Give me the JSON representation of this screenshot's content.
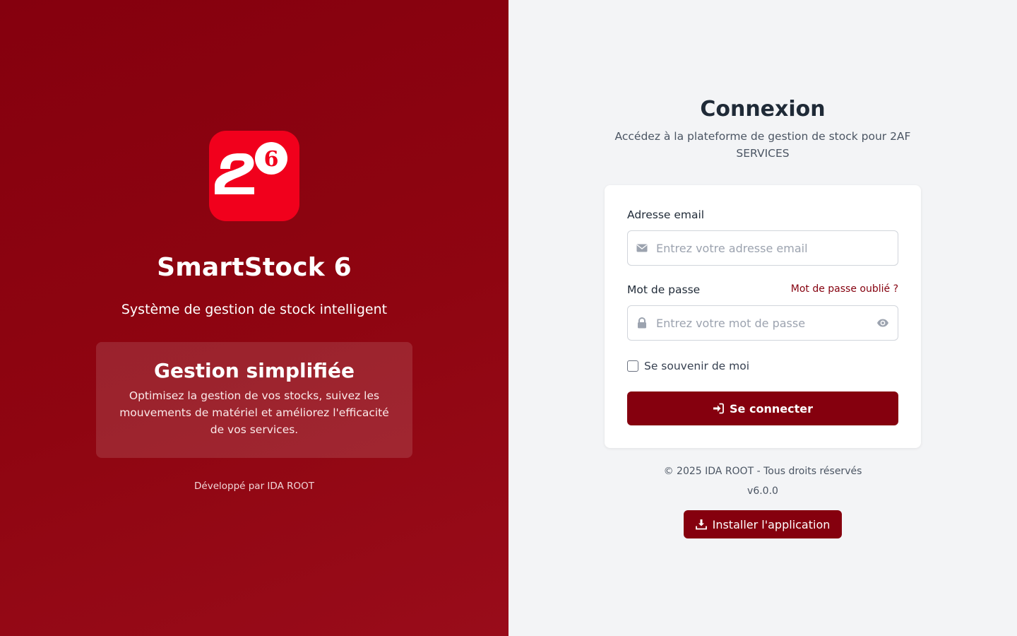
{
  "brand": {
    "app_name": "SmartStock 6",
    "tagline": "Système de gestion de stock intelligent",
    "logo_superscript": "6",
    "feature_title": "Gestion simplifiée",
    "feature_text": "Optimisez la gestion de vos stocks, suivez les mouvements de matériel et améliorez l'efficacité de vos services.",
    "developer": "Développé par IDA ROOT"
  },
  "login": {
    "title": "Connexion",
    "subtitle": "Accédez à la plateforme de gestion de stock pour 2AF SERVICES",
    "email_label": "Adresse email",
    "email_placeholder": "Entrez votre adresse email",
    "email_icon": "envelope-icon",
    "password_label": "Mot de passe",
    "password_placeholder": "Entrez votre mot de passe",
    "password_icon": "lock-icon",
    "toggle_icon": "eye-icon",
    "forgot_link": "Mot de passe oublié ?",
    "remember_label": "Se souvenir de moi",
    "remember_checked": false,
    "submit_label": "Se connecter",
    "submit_icon": "sign-in-icon"
  },
  "footer": {
    "copyright": "© 2025 IDA ROOT - Tous droits réservés",
    "version": "v6.0.0",
    "install_label": "Installer l'application",
    "install_icon": "download-icon"
  },
  "colors": {
    "brand_dark_red": "#85000e",
    "logo_red": "#f1001c",
    "page_background": "#f3f4f6",
    "heading": "#1f2a37"
  }
}
